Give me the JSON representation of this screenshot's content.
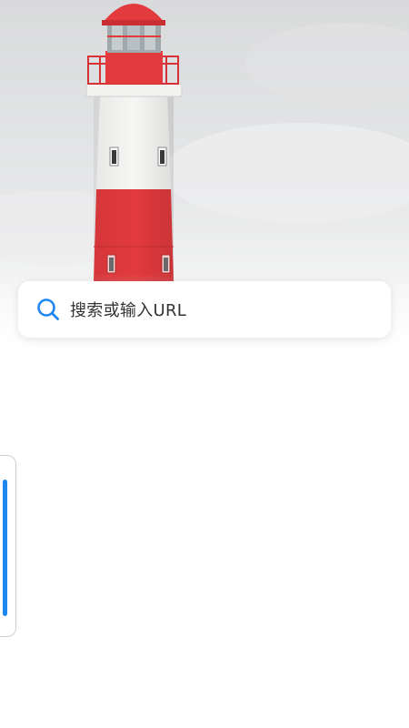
{
  "background": {
    "image": "lighthouse-photo",
    "colors": {
      "lighthouse_red": "#e23a3d",
      "lighthouse_white": "#f7f7f5",
      "sky": "#e6e7e8"
    }
  },
  "search": {
    "placeholder": "搜索或输入URL",
    "icon": "search-icon",
    "icon_color": "#1e88f0"
  },
  "side_handle": {
    "accent": "#1e88f0"
  }
}
